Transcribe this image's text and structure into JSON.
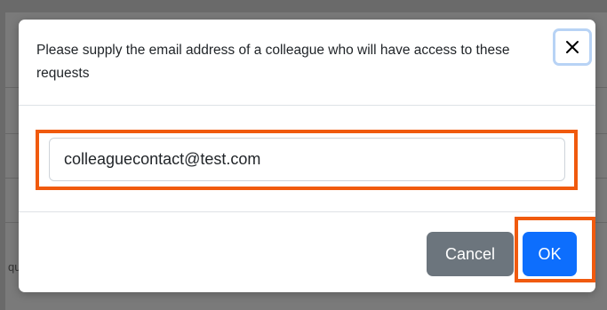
{
  "dialog": {
    "prompt": "Please supply the email address of a colleague who will have access to these requests",
    "close_icon": "close-icon",
    "email_value": "colleaguecontact@test.com",
    "cancel_label": "Cancel",
    "ok_label": "OK"
  },
  "background": {
    "fragment": "qu"
  },
  "colors": {
    "primary": "#0d6efd",
    "secondary": "#6c757d",
    "highlight": "#f05a0e",
    "overlay": "#7a7a7a"
  }
}
